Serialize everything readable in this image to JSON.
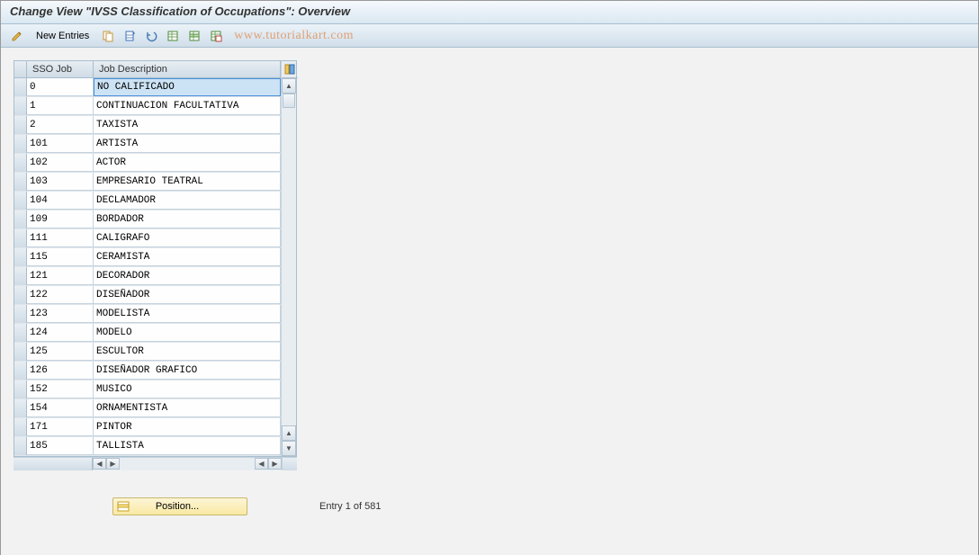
{
  "header": {
    "title": "Change View \"IVSS Classification of Occupations\": Overview"
  },
  "toolbar": {
    "new_entries_label": "New Entries",
    "watermark": "www.tutorialkart.com"
  },
  "table": {
    "columns": {
      "col1": "SSO Job",
      "col2": "Job Description"
    },
    "rows": [
      {
        "sso": "0",
        "desc": "NO CALIFICADO",
        "selected": true
      },
      {
        "sso": "1",
        "desc": "CONTINUACION FACULTATIVA"
      },
      {
        "sso": "2",
        "desc": "TAXISTA"
      },
      {
        "sso": "101",
        "desc": "ARTISTA"
      },
      {
        "sso": "102",
        "desc": "ACTOR"
      },
      {
        "sso": "103",
        "desc": "EMPRESARIO TEATRAL"
      },
      {
        "sso": "104",
        "desc": "DECLAMADOR"
      },
      {
        "sso": "109",
        "desc": "BORDADOR"
      },
      {
        "sso": "111",
        "desc": "CALIGRAFO"
      },
      {
        "sso": "115",
        "desc": "CERAMISTA"
      },
      {
        "sso": "121",
        "desc": "DECORADOR"
      },
      {
        "sso": "122",
        "desc": "DISEÑADOR"
      },
      {
        "sso": "123",
        "desc": "MODELISTA"
      },
      {
        "sso": "124",
        "desc": "MODELO"
      },
      {
        "sso": "125",
        "desc": "ESCULTOR"
      },
      {
        "sso": "126",
        "desc": "DISEÑADOR GRAFICO"
      },
      {
        "sso": "152",
        "desc": "MUSICO"
      },
      {
        "sso": "154",
        "desc": "ORNAMENTISTA"
      },
      {
        "sso": "171",
        "desc": "PINTOR"
      },
      {
        "sso": "185",
        "desc": "TALLISTA"
      }
    ]
  },
  "footer": {
    "position_label": "Position...",
    "entry_text": "Entry 1 of 581"
  }
}
